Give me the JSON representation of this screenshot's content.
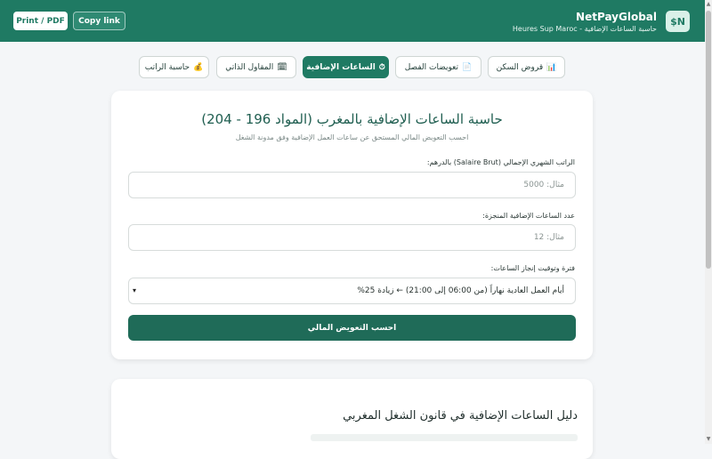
{
  "header": {
    "print_label": "Print / PDF",
    "copy_label": "Copy link",
    "brand": "NetPayGlobal",
    "subtitle": "Heures Sup Maroc - حاسبة الساعات الإضافية",
    "logo_text": "$N",
    "bg_color": "#1f7a63"
  },
  "tabs": [
    {
      "label": "قروض السكن",
      "icon": "📊"
    },
    {
      "label": "تعويضات الفصل",
      "icon": "📄"
    },
    {
      "label": "الساعات الإضافية",
      "icon": "⏱",
      "active": true
    },
    {
      "label": "المقاول الذاتي",
      "icon": "🗓"
    },
    {
      "label": "حاسبة الراتب",
      "icon": "💰"
    }
  ],
  "calculator": {
    "title": "حاسبة الساعات الإضافية بالمغرب (المواد 196 - 204)",
    "subtitle": "احسب التعويض المالي المستحق عن ساعات العمل الإضافية وفق مدونة الشغل",
    "salary_label": "الراتب الشهري الإجمالي (Salaire Brut) بالدرهم:",
    "salary_placeholder": "مثال: 5000",
    "hours_label": "عدد الساعات الإضافية المنجزة:",
    "hours_placeholder": "مثال: 12",
    "period_label": "فترة وتوقيت إنجاز الساعات:",
    "period_value": "أيام العمل العادية نهاراً (من 06:00 إلى 21:00) ← زيادة 25%",
    "submit_label": "احسب التعويض المالي"
  },
  "guide": {
    "title": "دليل الساعات الإضافية في قانون الشغل المغربي"
  }
}
